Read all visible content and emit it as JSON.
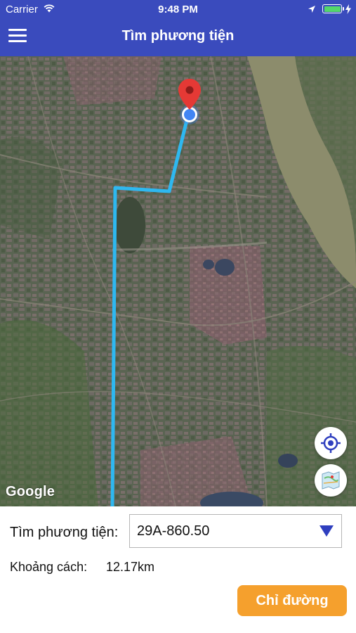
{
  "status_bar": {
    "carrier": "Carrier",
    "time": "9:48 PM",
    "battery_color": "#53d76a"
  },
  "header": {
    "title": "Tìm phương tiện",
    "menu_icon": "hamburger-menu-icon",
    "background": "#3a4bbd"
  },
  "map": {
    "attribution": "Google",
    "route_color": "#2eb8f0",
    "marker_color": "#e53935",
    "buttons": {
      "my_location_icon": "crosshair-icon",
      "map_type_icon": "map-layer-icon"
    }
  },
  "panel": {
    "vehicle_label": "Tìm phương tiện:",
    "vehicle_selected": "29A-860.50",
    "distance_label": "Khoảng cách:",
    "distance_value": "12.17km",
    "directions_button": "Chỉ đường",
    "directions_button_color": "#f5a02d"
  }
}
